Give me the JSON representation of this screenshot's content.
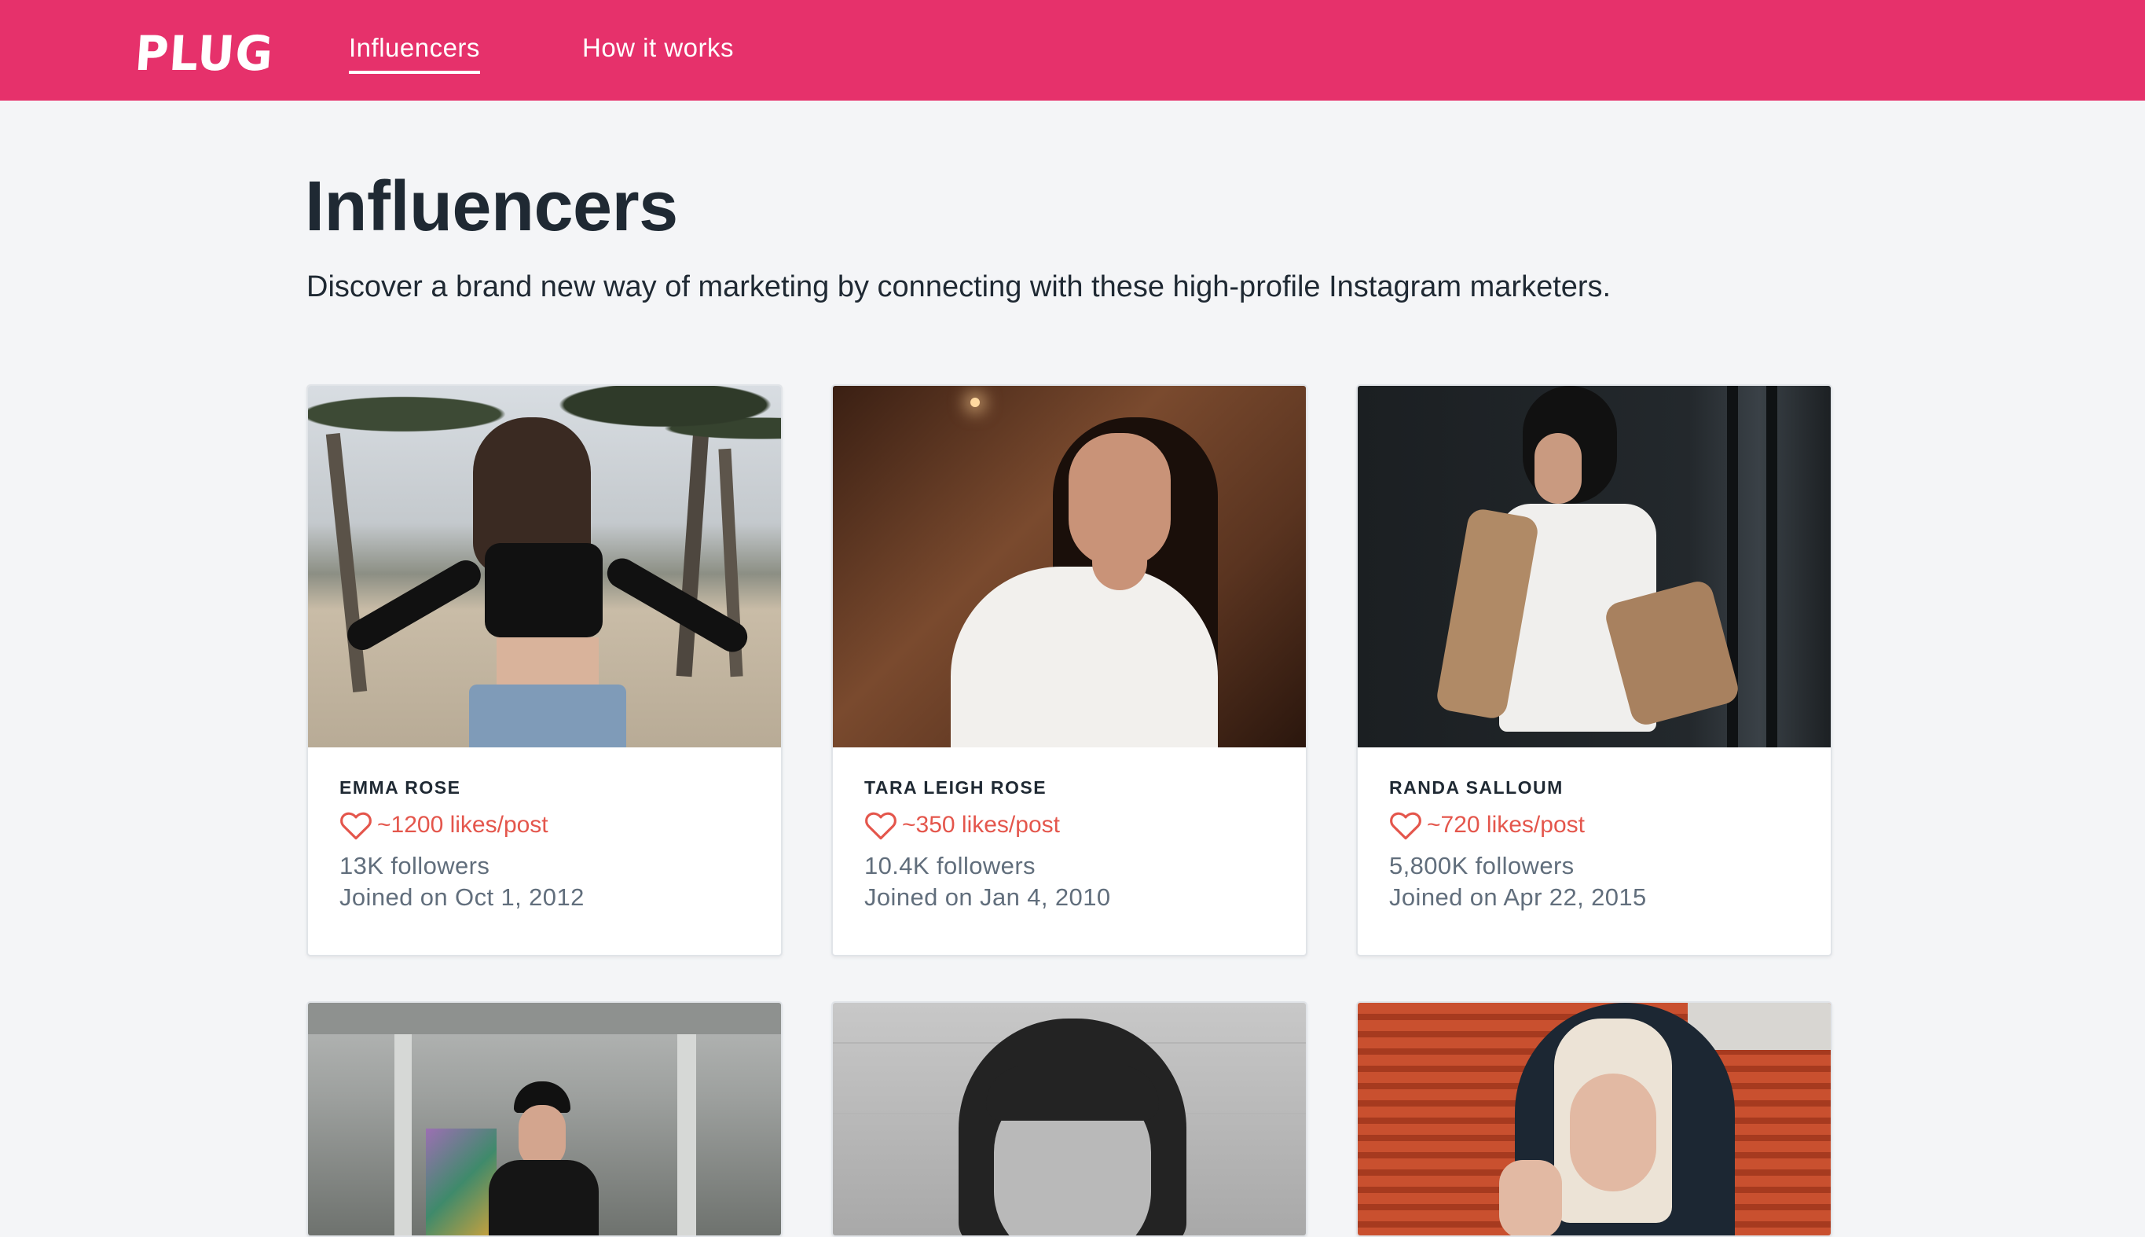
{
  "nav": {
    "logo": "PLUG",
    "links": [
      {
        "label": "Influencers",
        "active": true
      },
      {
        "label": "How it works",
        "active": false
      }
    ]
  },
  "page": {
    "title": "Influencers",
    "subtitle": "Discover a brand new way of marketing by connecting with these high-profile Instagram marketers."
  },
  "influencers": [
    {
      "name": "EMMA ROSE",
      "likes": "~1200 likes/post",
      "followers": "13K followers",
      "joined": "Joined on Oct 1, 2012"
    },
    {
      "name": "TARA LEIGH ROSE",
      "likes": "~350 likes/post",
      "followers": "10.4K followers",
      "joined": "Joined on Jan 4, 2010"
    },
    {
      "name": "RANDA SALLOUM",
      "likes": "~720 likes/post",
      "followers": "5,800K followers",
      "joined": "Joined on Apr 22, 2015"
    }
  ],
  "colors": {
    "brand": "#e6316b",
    "likes": "#e4564c",
    "background": "#f4f5f7",
    "text": "#1f2933",
    "muted": "#616e7c"
  },
  "icons": {
    "likes": "heart-outline-icon"
  }
}
